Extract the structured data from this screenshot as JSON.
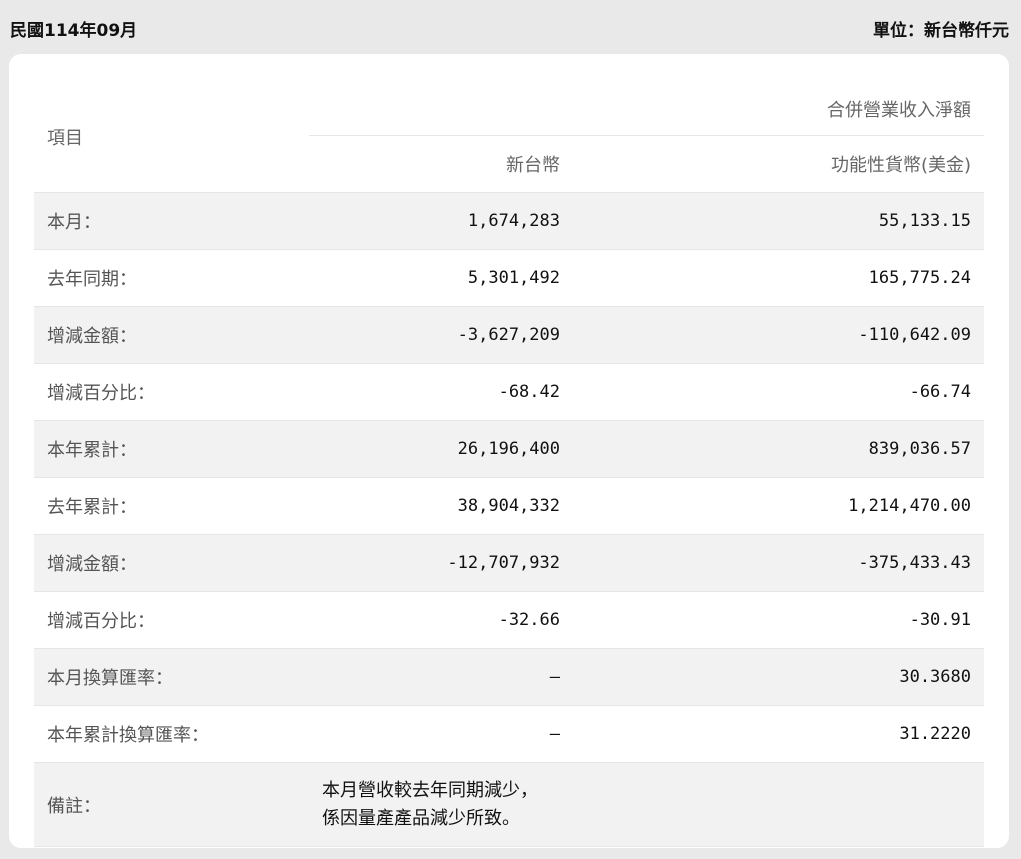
{
  "header": {
    "period": "民國114年09月",
    "unit": "單位：新台幣仟元"
  },
  "table": {
    "item_header": "項目",
    "group_header": "合併營業收入淨額",
    "col_twd": "新台幣",
    "col_usd": "功能性貨幣(美金)",
    "rows": [
      {
        "label": "本月：",
        "twd": "1,674,283",
        "usd": "55,133.15"
      },
      {
        "label": "去年同期：",
        "twd": "5,301,492",
        "usd": "165,775.24"
      },
      {
        "label": "增減金額：",
        "twd": "-3,627,209",
        "usd": "-110,642.09"
      },
      {
        "label": "增減百分比：",
        "twd": "-68.42",
        "usd": "-66.74"
      },
      {
        "label": "本年累計：",
        "twd": "26,196,400",
        "usd": "839,036.57"
      },
      {
        "label": "去年累計：",
        "twd": "38,904,332",
        "usd": "1,214,470.00"
      },
      {
        "label": "增減金額：",
        "twd": "-12,707,932",
        "usd": "-375,433.43"
      },
      {
        "label": "增減百分比：",
        "twd": "-32.66",
        "usd": "-30.91"
      },
      {
        "label": "本月換算匯率：",
        "twd": "–",
        "usd": "30.3680"
      },
      {
        "label": "本年累計換算匯率：",
        "twd": "–",
        "usd": "31.2220"
      }
    ],
    "remark_label": "備註：",
    "remark_line1": "本月營收較去年同期減少，",
    "remark_line2": "係因量產產品減少所致。"
  }
}
